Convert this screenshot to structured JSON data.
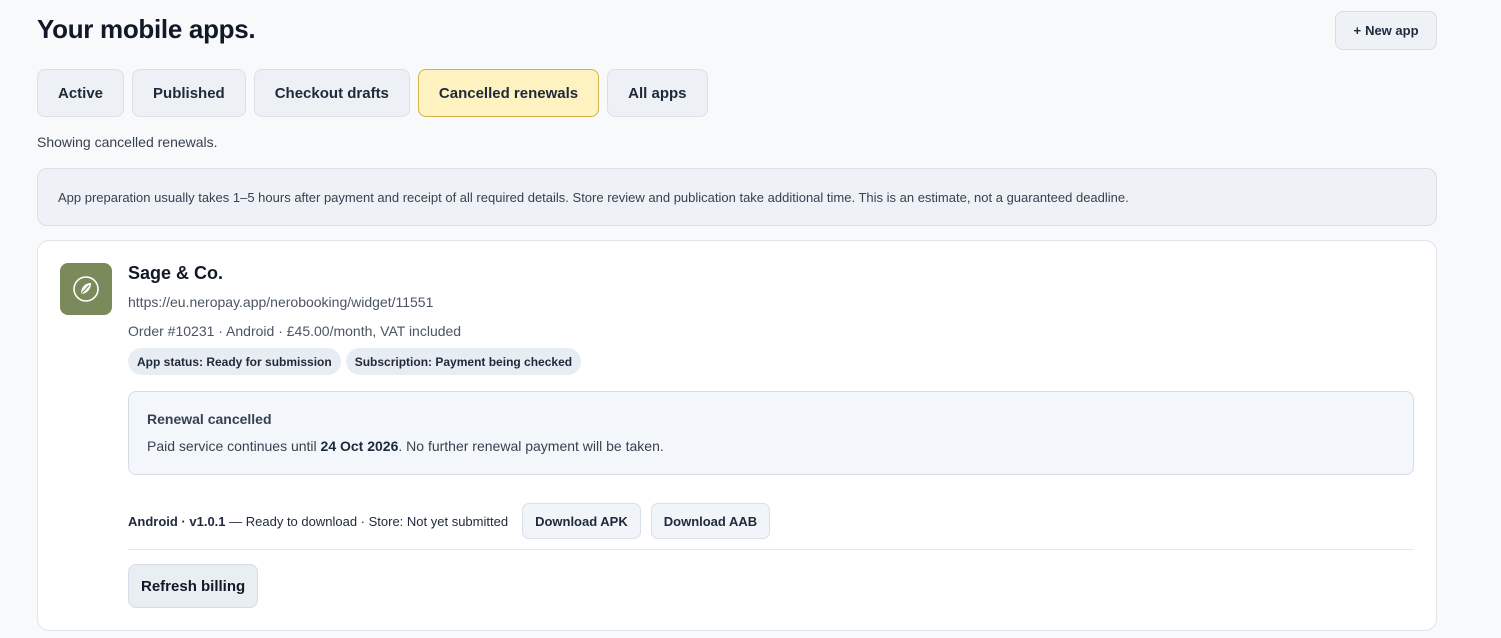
{
  "header": {
    "title": "Your mobile apps.",
    "new_app_icon": "+",
    "new_app_label": "New app"
  },
  "tabs": [
    {
      "label": "Active"
    },
    {
      "label": "Published"
    },
    {
      "label": "Checkout drafts"
    },
    {
      "label": "Cancelled renewals",
      "active": true
    },
    {
      "label": "All apps"
    }
  ],
  "filter_note": "Showing cancelled renewals.",
  "info": "App preparation usually takes 1–5 hours after payment and receipt of all required details. Store review and publication take additional time. This is an estimate, not a guaranteed deadline.",
  "app": {
    "logo_icon": "leaf-icon",
    "name": "Sage & Co.",
    "url": "https://eu.neropay.app/nerobooking/widget/11551",
    "order_line": "Order #10231 · Android · £45.00/month, VAT included",
    "badges": {
      "app_status": "App status: Ready for submission",
      "subscription": "Subscription: Payment being checked"
    },
    "renewal": {
      "title": "Renewal cancelled",
      "text_before": "Paid service continues until ",
      "date": "24 Oct 2026",
      "text_after": ". No further renewal payment will be taken."
    },
    "build": {
      "platform_version": "Android · v1.0.1",
      "status": " — Ready to download · Store: Not yet submitted",
      "download_apk": "Download APK",
      "download_aab": "Download AAB"
    },
    "refresh_billing": "Refresh billing"
  },
  "colors": {
    "background": "#f7f9fb",
    "active_tab": "#fdf2c0",
    "active_tab_border": "#d6b04a",
    "logo_bg": "#7a8a5a"
  }
}
